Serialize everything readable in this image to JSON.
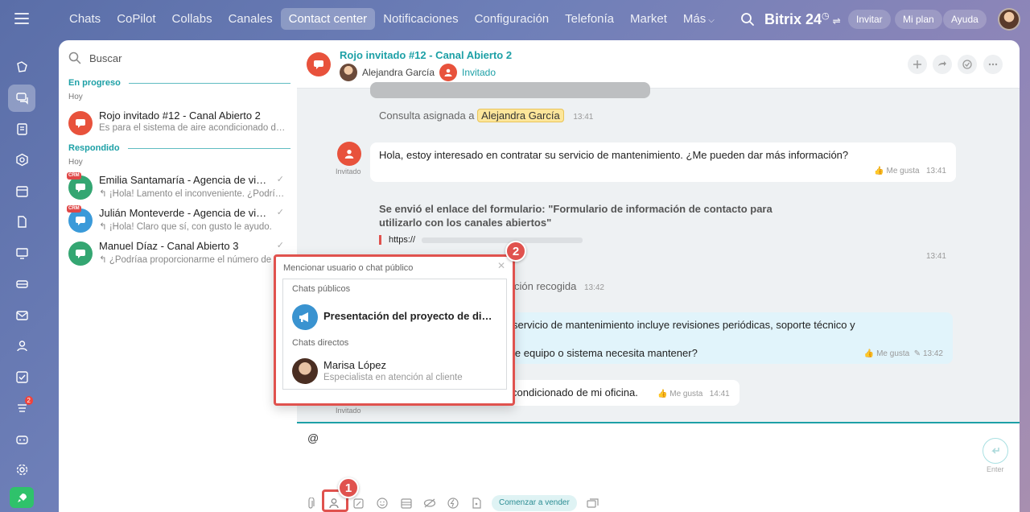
{
  "topbar": {
    "nav": [
      "Chats",
      "CoPilot",
      "Collabs",
      "Canales",
      "Contact center",
      "Notificaciones",
      "Configuración",
      "Telefonía",
      "Market",
      "Más"
    ],
    "active_index": 4,
    "brand": "Bitrix 24",
    "buttons": [
      "Invitar",
      "Mi plan",
      "Ayuda"
    ]
  },
  "rail": {
    "icons": [
      "feed-icon",
      "chat-icon",
      "tasks-icon",
      "crm-icon",
      "calendar-icon",
      "documents-icon",
      "sites-icon",
      "store-icon",
      "mail-icon",
      "employees-icon",
      "checklist-icon",
      "automation-icon",
      "bot-icon",
      "settings-icon",
      "rocket-icon"
    ],
    "active_index": 1,
    "badge": "2"
  },
  "list": {
    "search_placeholder": "Buscar",
    "sections": [
      {
        "title": "En progreso",
        "day": "Hoy",
        "items": [
          {
            "title": "Rojo invitado #12 - Canal Abierto 2",
            "subtitle": "Es para el sistema de aire acondicionado de mi oficina.",
            "crm": false
          }
        ]
      },
      {
        "title": "Respondido",
        "day": "Hoy",
        "items": [
          {
            "title": "Emilia Santamaría - Agencia de viajes",
            "subtitle": "¡Hola! Lamento el inconveniente. ¿Podría darme más detalles?",
            "crm": true
          },
          {
            "title": "Julián Monteverde - Agencia de viajes",
            "subtitle": "¡Hola! Claro que sí, con gusto le ayudo.",
            "crm": true
          },
          {
            "title": "Manuel Díaz - Canal Abierto 3",
            "subtitle": "¿Podríaa proporcionarme el número de pedido?",
            "crm": false
          }
        ]
      }
    ],
    "crm_label": "CRM"
  },
  "chat": {
    "title": "Rojo invitado #12 - Canal Abierto 2",
    "members": [
      {
        "name": "Alejandra García"
      },
      {
        "name": "Invitado"
      }
    ],
    "assigned_prefix": "Consulta asignada a",
    "assigned_name": "Alejandra García",
    "assigned_time": "13:41",
    "msg1": {
      "text": "Hola, estoy interesado en contratar su servicio de mantenimiento. ¿Me pueden dar más información?",
      "like": "Me gusta",
      "time": "13:41"
    },
    "sender_label": "Invitado",
    "form_msg": {
      "text": "Se envió el enlace del formulario: \"Formulario de información de contacto para utilizarlo con los canales abiertos\"",
      "link": "https://",
      "time": "13:41"
    },
    "collected": {
      "text": "ción recogida",
      "time": "13:42"
    },
    "reply": {
      "line1": "servicio de mantenimiento incluye revisiones periódicas, soporte técnico y",
      "line2": "le equipo o sistema necesita mantener?",
      "like": "Me gusta",
      "time": "13:42"
    },
    "msg3": {
      "text": "condicionado de mi oficina.",
      "like": "Me gusta",
      "time": "14:41"
    },
    "composer_text": "@",
    "enter_label": "Enter",
    "sell_label": "Comenzar a vender"
  },
  "popup": {
    "title": "Mencionar usuario o chat público",
    "public_label": "Chats públicos",
    "public_item": "Presentación del proyecto de diseño",
    "direct_label": "Chats directos",
    "direct_name": "Marisa López",
    "direct_role": "Especialista en atención al cliente"
  },
  "callouts": [
    "1",
    "2"
  ]
}
